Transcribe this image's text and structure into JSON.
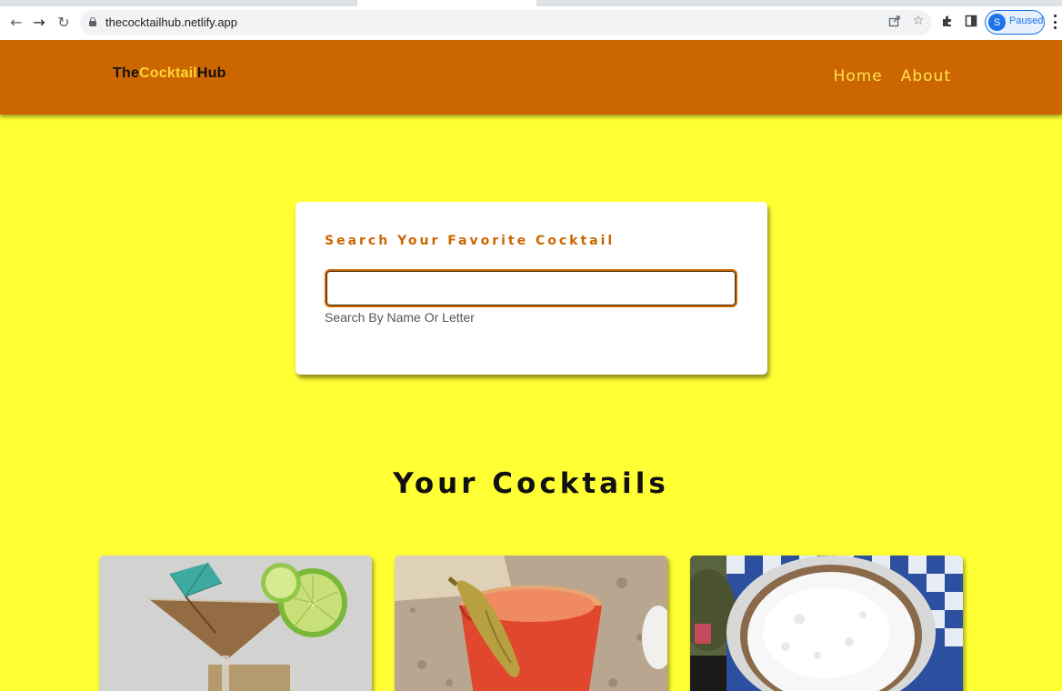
{
  "browser": {
    "url": "thecocktailhub.netlify.app",
    "profile_initial": "S",
    "profile_status": "Paused",
    "icons": [
      "back-icon",
      "forward-icon",
      "reload-icon",
      "lock-icon",
      "share-icon",
      "star-icon",
      "extensions-icon",
      "sidepanel-icon",
      "menu-icon"
    ]
  },
  "site": {
    "logo": {
      "part1": "The",
      "part2": "Cocktail",
      "part3": "Hub"
    },
    "nav": {
      "home": "Home",
      "about": "About"
    }
  },
  "search": {
    "title": "Search Your Favorite Cocktail",
    "value": "",
    "hint": "Search By Name Or Letter"
  },
  "cocktails": {
    "heading": "Your Cocktails",
    "cards": [
      {
        "image": "martini-with-lime-and-umbrella"
      },
      {
        "image": "bloody-mary-with-okra"
      },
      {
        "image": "frothy-coffee-drink"
      }
    ]
  },
  "colors": {
    "page_bg": "#ffff33",
    "nav_bg": "#cc6600",
    "accent": "#cc6600",
    "nav_link": "#ffe14d",
    "logo_highlight": "#ffd633"
  }
}
